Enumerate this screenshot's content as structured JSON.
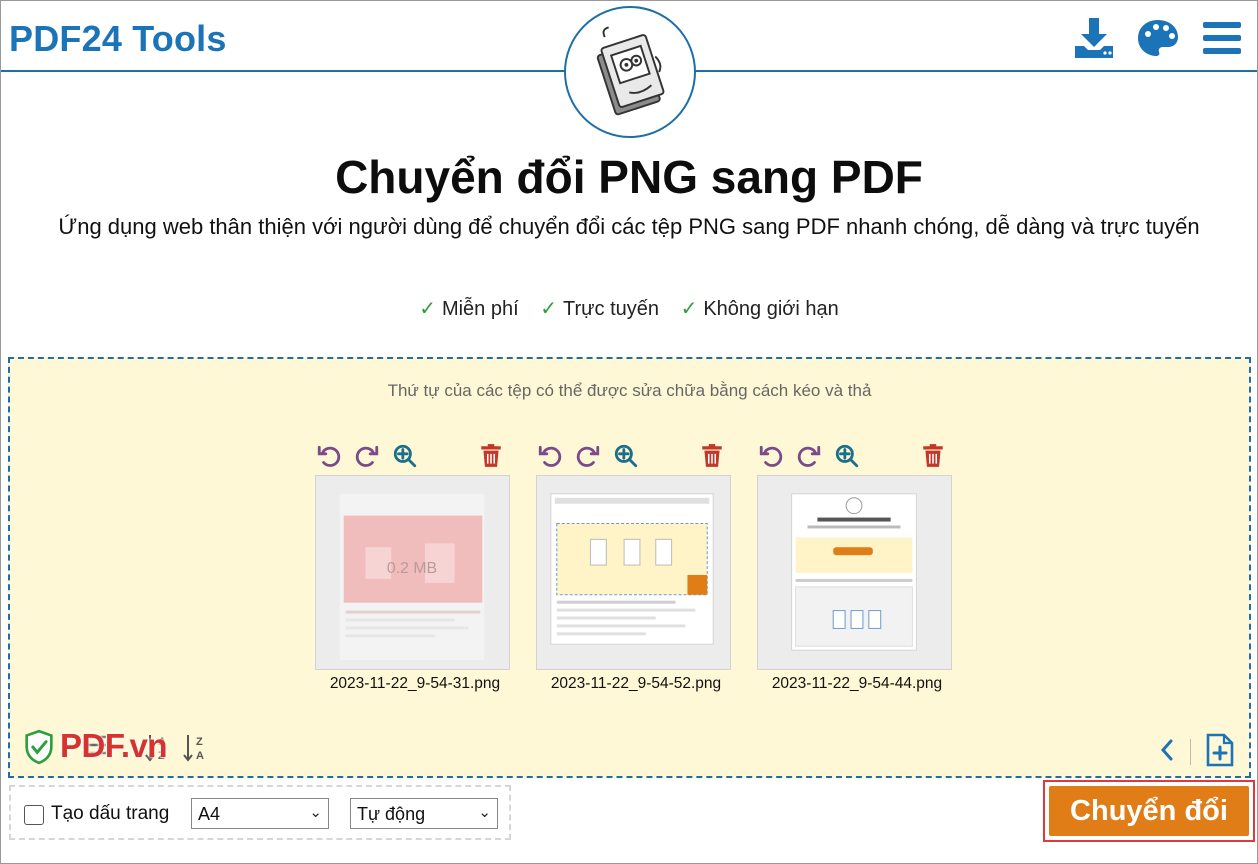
{
  "header": {
    "brand": "PDF24 Tools",
    "icons": [
      "download-icon",
      "palette-icon",
      "menu-icon"
    ]
  },
  "hero": {
    "title": "Chuyển đổi PNG sang PDF",
    "subtitle": "Ứng dụng web thân thiện với người dùng để chuyển đổi các tệp PNG sang PDF nhanh chóng, dễ dàng và trực tuyến",
    "features": [
      "Miễn phí",
      "Trực tuyến",
      "Không giới hạn"
    ]
  },
  "dropzone": {
    "hint": "Thứ tự của các tệp có thể được sửa chữa bằng cách kéo và thả",
    "files": [
      {
        "name": "2023-11-22_9-54-31.png",
        "size": "0.2 MB"
      },
      {
        "name": "2023-11-22_9-54-52.png"
      },
      {
        "name": "2023-11-22_9-54-44.png"
      }
    ],
    "watermark": "PDF.vn"
  },
  "options": {
    "bookmark_label": "Tạo dấu trang",
    "page_size": "A4",
    "orientation": "Tự động"
  },
  "actions": {
    "convert_label": "Chuyển đổi"
  },
  "colors": {
    "brand_blue": "#1b74b8",
    "dropzone_bg": "#fff8d6",
    "convert_orange": "#e07d16",
    "delete_red": "#c0392b",
    "rotate_purple": "#7a4a8a"
  }
}
